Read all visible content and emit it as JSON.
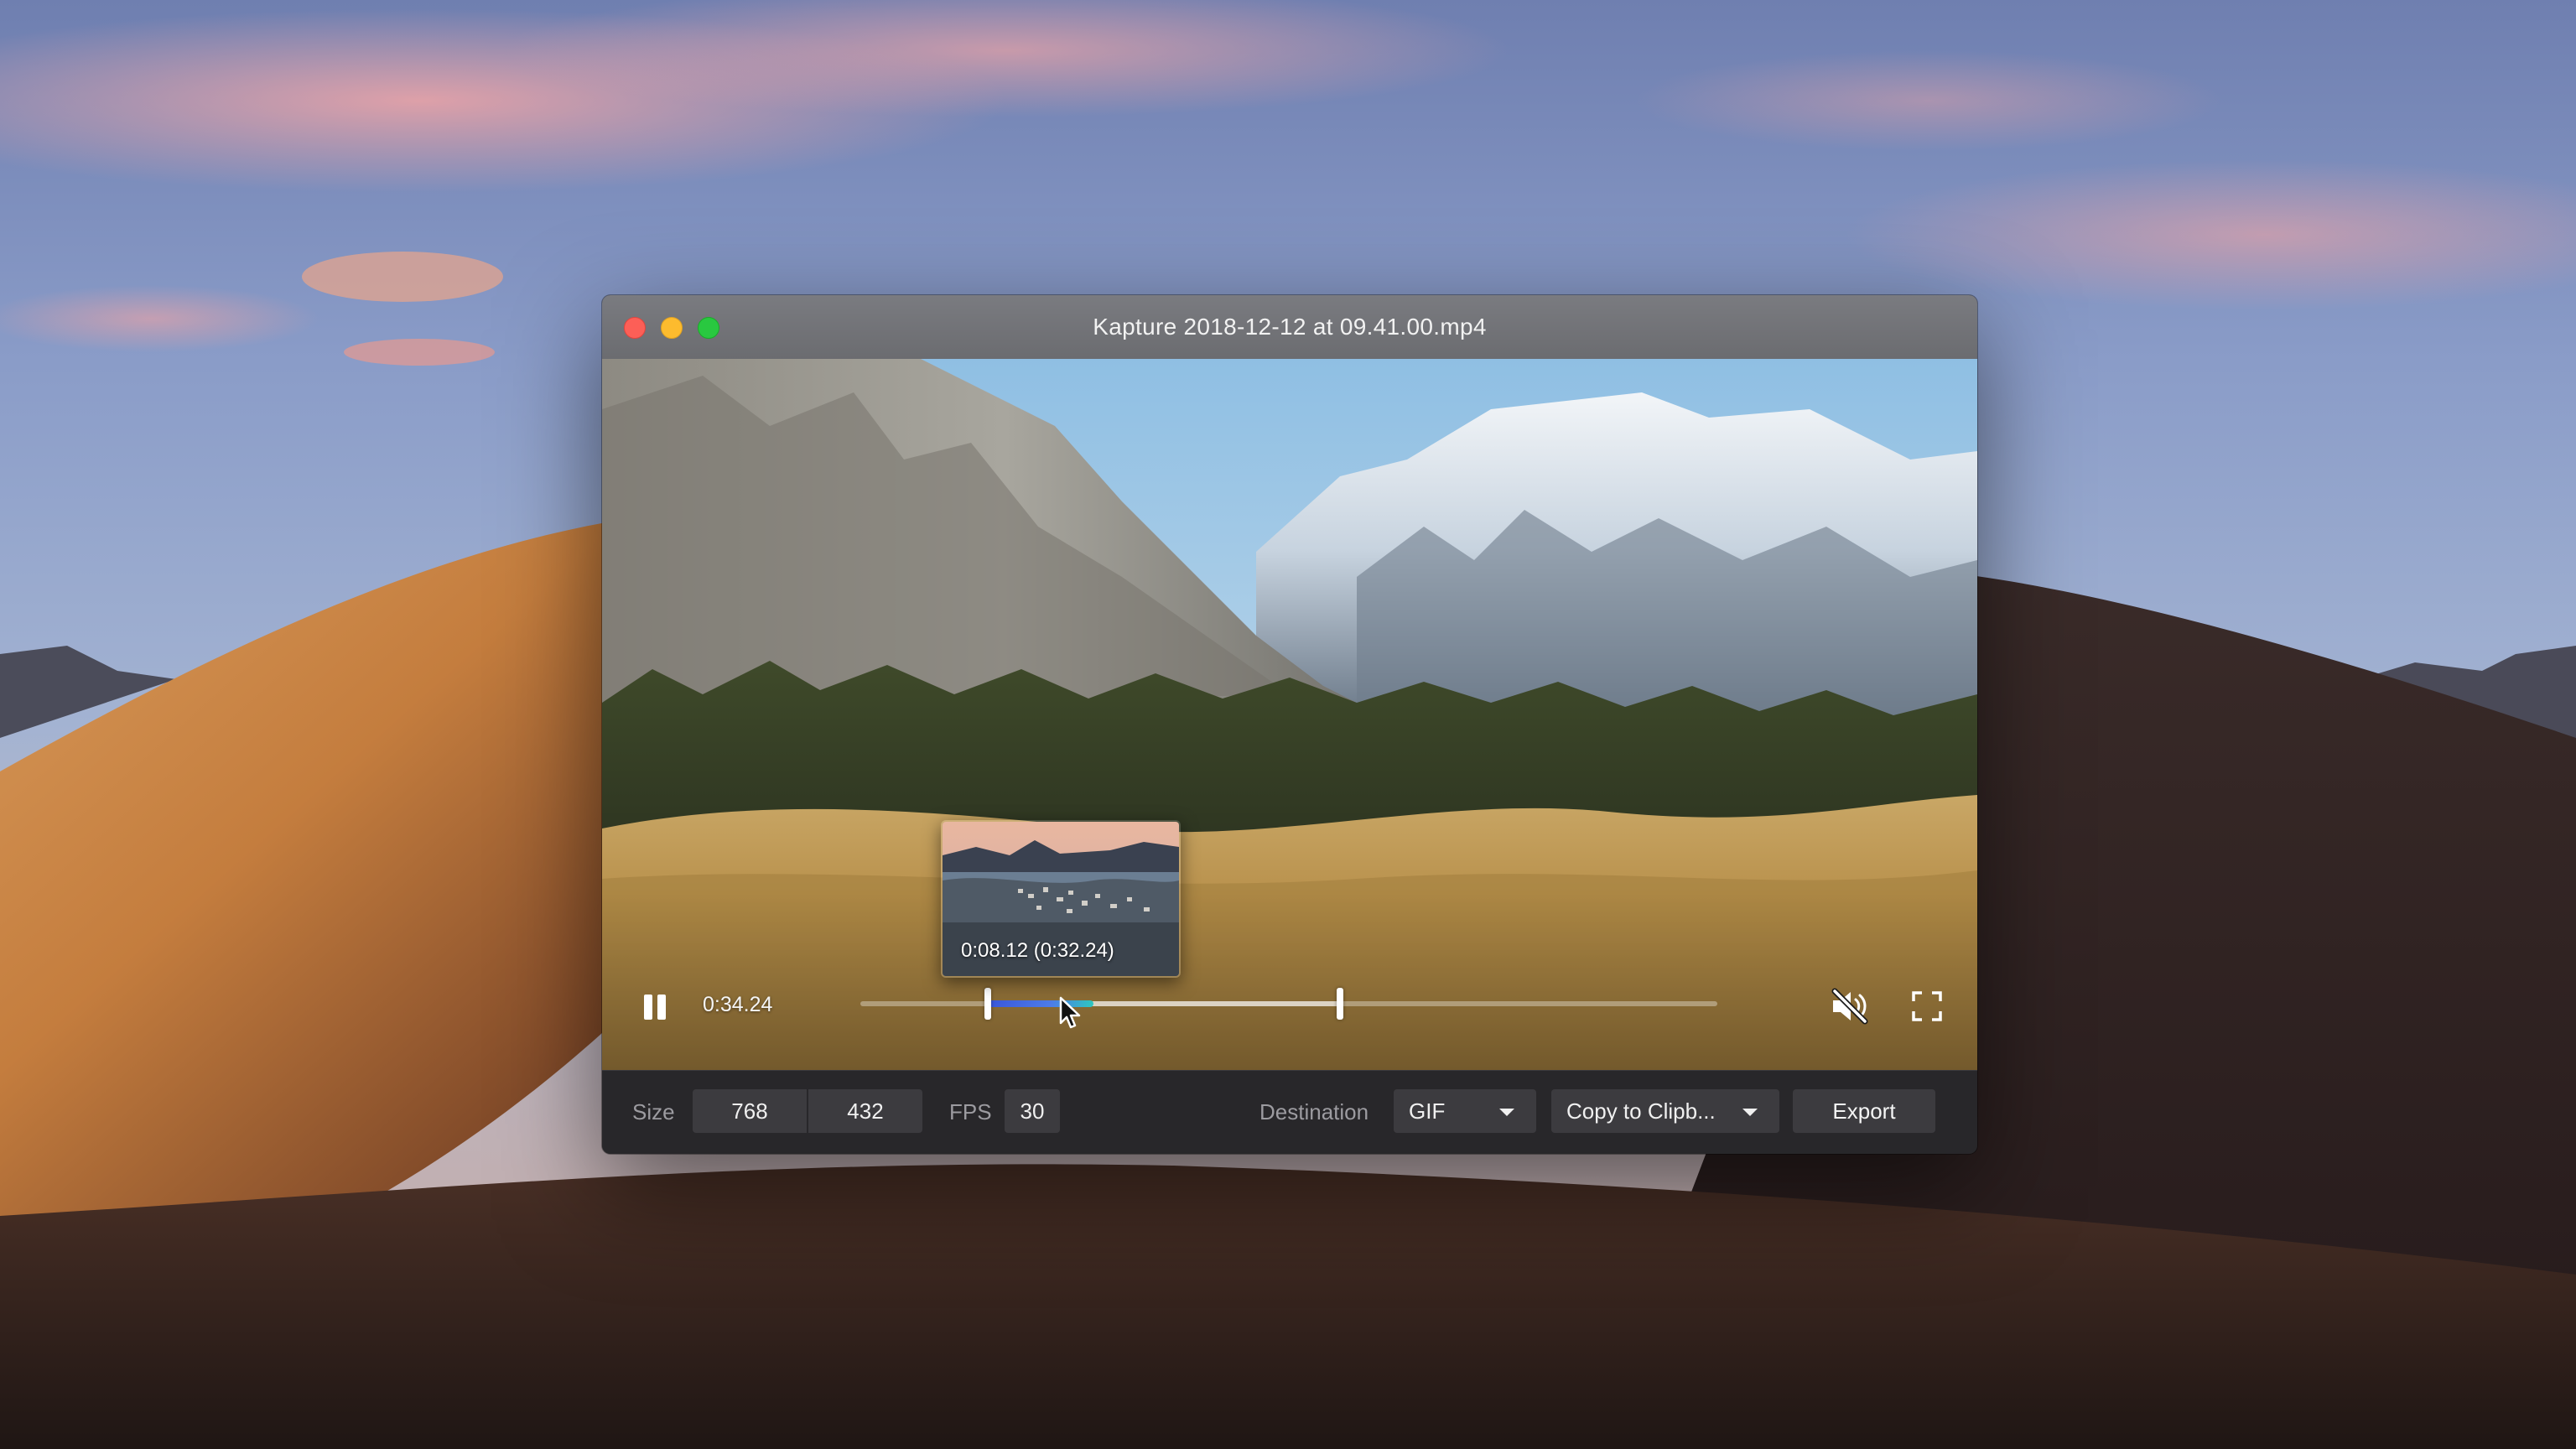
{
  "window": {
    "title": "Kapture 2018-12-12 at 09.41.00.mp4"
  },
  "player": {
    "current_time": "0:34.24",
    "preview_time": "0:08.12 (0:32.24)",
    "muted": true
  },
  "toolbar": {
    "size_label": "Size",
    "width_value": "768",
    "height_value": "432",
    "fps_label": "FPS",
    "fps_value": "30",
    "destination_label": "Destination",
    "format_value": "GIF",
    "destination_value": "Copy to Clipb...",
    "export_label": "Export"
  },
  "colors": {
    "accent_gradient_start": "#3a57d9",
    "accent_gradient_end": "#2fc7c1",
    "close": "#fc5f57",
    "minimize": "#fdbb2e",
    "maximize": "#29c840"
  },
  "icons": {
    "play_pause": "pause-icon",
    "mute": "speaker-muted-icon",
    "fullscreen": "fullscreen-icon"
  }
}
